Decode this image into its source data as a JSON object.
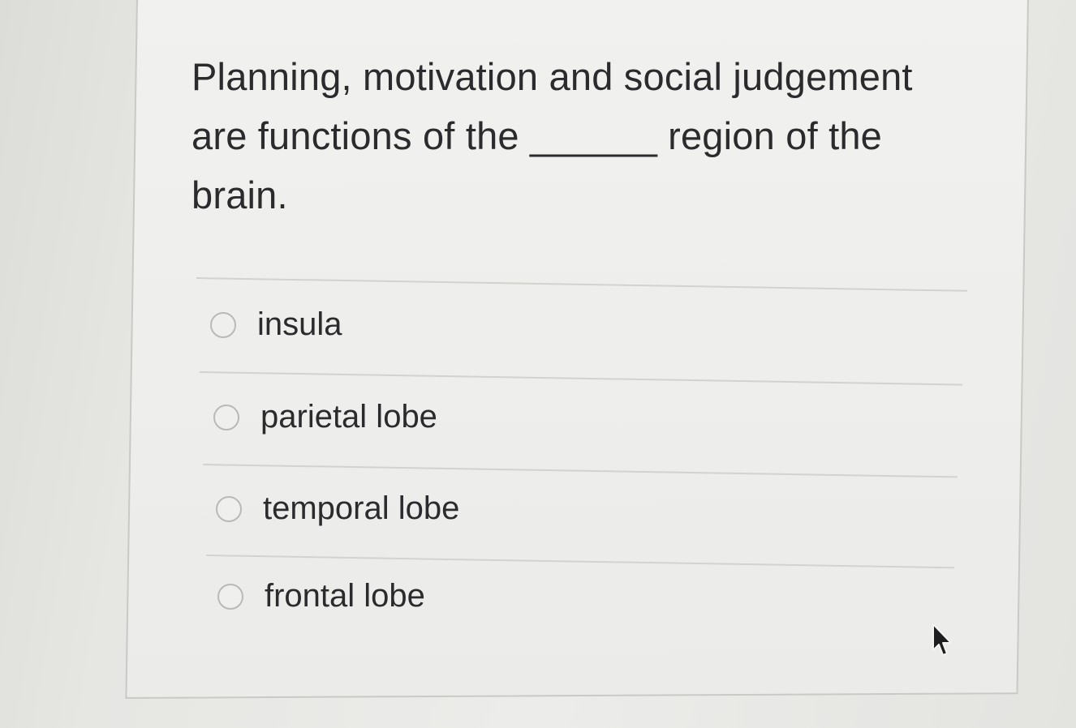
{
  "question": {
    "text_part1": "Planning, motivation and social judgement are functions of the ",
    "blank": "______",
    "text_part2": " region of the brain."
  },
  "answers": [
    {
      "label": "insula",
      "selected": false
    },
    {
      "label": "parietal lobe",
      "selected": false
    },
    {
      "label": "temporal lobe",
      "selected": false
    },
    {
      "label": "frontal lobe",
      "selected": false
    }
  ],
  "icons": {
    "radio": "radio-button-empty-icon",
    "cursor": "mouse-pointer-icon"
  },
  "colors": {
    "text": "#2b2b2e",
    "divider": "#d2d2cf",
    "radio_border": "#b9b9b6",
    "card_background": "#eeeeec"
  }
}
